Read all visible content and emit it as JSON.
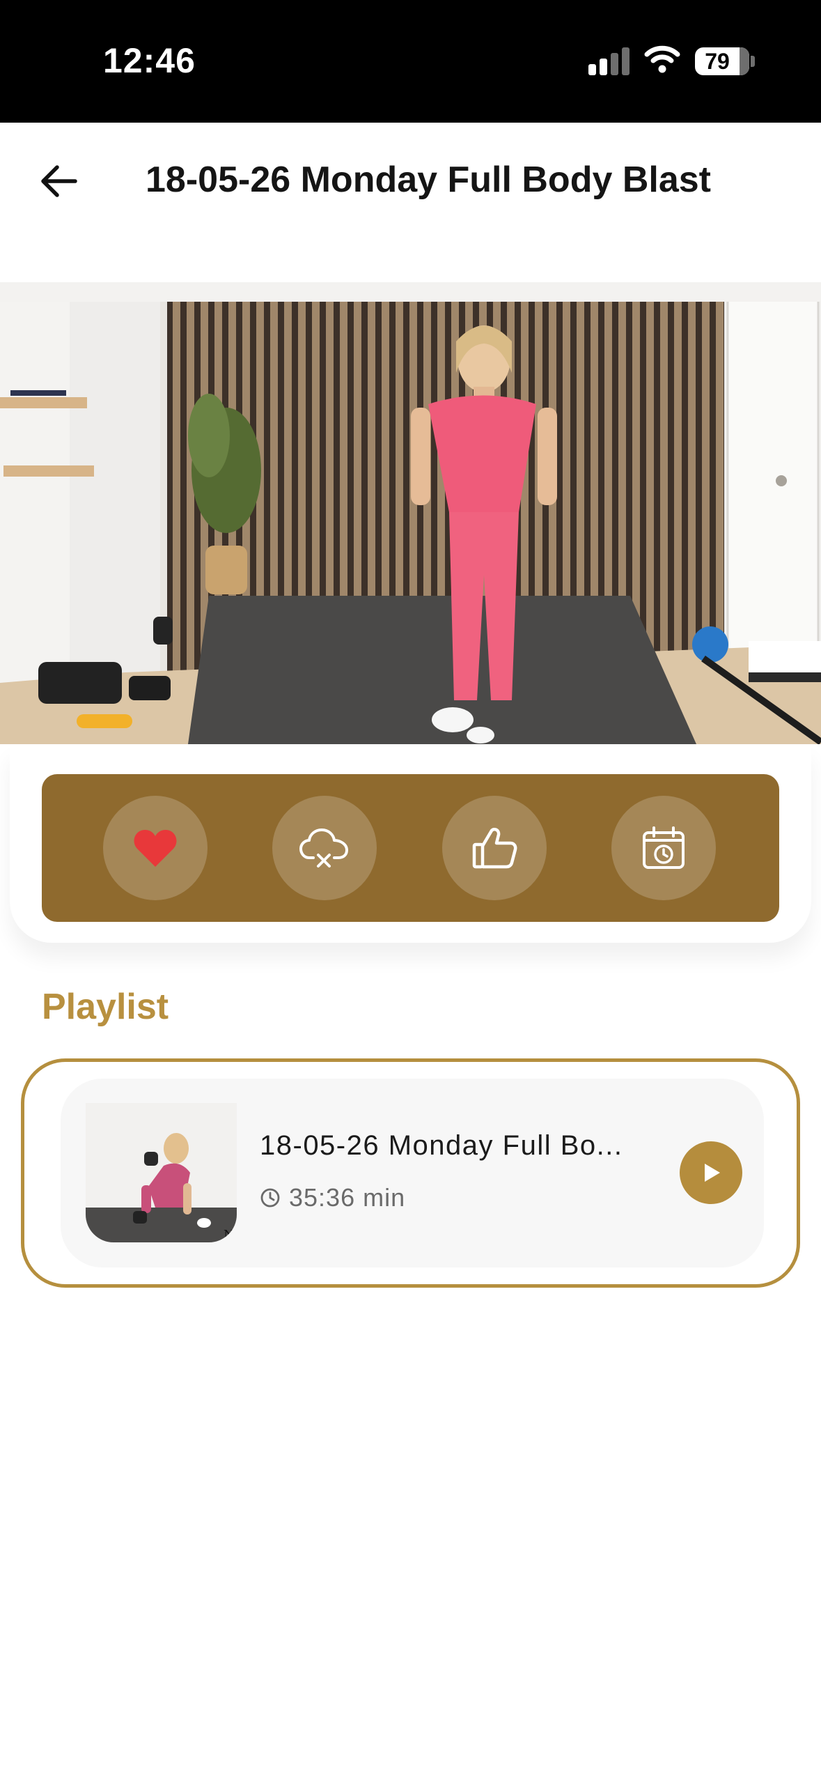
{
  "status_bar": {
    "time": "12:46",
    "battery": "79",
    "icons": [
      "signal-icon",
      "wifi-icon",
      "battery-icon"
    ]
  },
  "header": {
    "back_icon": "arrow-left-icon",
    "title": "18-05-26 Monday Full Body Blast"
  },
  "actions": [
    {
      "name": "favorite",
      "icon": "heart-icon"
    },
    {
      "name": "download-removed",
      "icon": "cloud-x-icon"
    },
    {
      "name": "like",
      "icon": "thumbs-up-icon"
    },
    {
      "name": "schedule",
      "icon": "calendar-clock-icon"
    }
  ],
  "playlist": {
    "heading": "Playlist",
    "items": [
      {
        "title": "18-05-26 Monday Full Bo...",
        "duration": "35:36 min",
        "thumb_caption": "N"
      }
    ]
  },
  "colors": {
    "accent": "#8f6a2e",
    "heading_gold": "#b8903f",
    "frame_gold": "#b58f3e",
    "heart_red": "#e8383a",
    "play_gold": "#b58d3d"
  }
}
